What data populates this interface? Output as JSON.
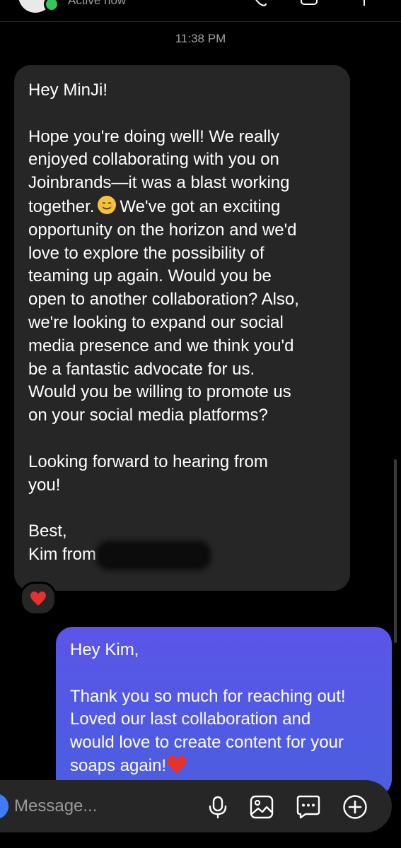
{
  "header": {
    "status": "Active now"
  },
  "timestamp": "11:38 PM",
  "incoming_message": {
    "lines": [
      "Hey MinJi!",
      "",
      "Hope you're doing well! We really",
      "enjoyed collaborating with you on",
      "Joinbrands—it was a blast working",
      "together.",
      "We've got an exciting",
      "opportunity on the horizon and we'd",
      "love to explore the possibility of",
      "teaming up again. Would you be",
      "open to another collaboration? Also,",
      "we're looking to expand our social",
      "media presence and we think you'd",
      "be a fantastic advocate for us.",
      "Would you be willing to promote us",
      "on your social media platforms?",
      "",
      "Looking forward to hearing from",
      "you!",
      "",
      "Best,",
      "Kim from"
    ],
    "reaction": "heart"
  },
  "outgoing_message": {
    "lines": [
      "Hey Kim,",
      "",
      "Thank you so much for reaching out!",
      "Loved our last collaboration and",
      "would love to create content for your",
      "soaps again!"
    ]
  },
  "composer": {
    "placeholder": "Message..."
  },
  "colors": {
    "incoming_bubble": "#262626",
    "outgoing_bubble": "#5158e6",
    "online": "#35c759",
    "heart": "#e5322d"
  }
}
